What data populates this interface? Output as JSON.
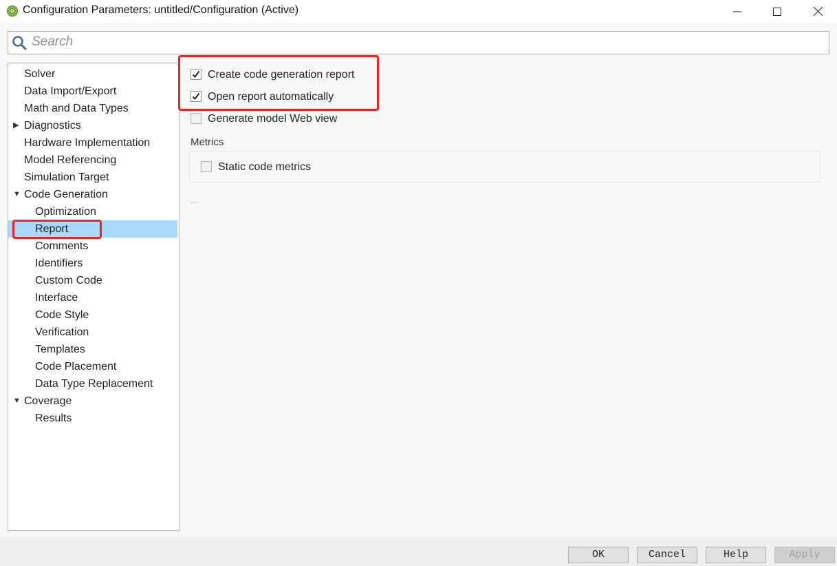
{
  "window": {
    "title": "Configuration Parameters: untitled/Configuration (Active)"
  },
  "search": {
    "placeholder": "Search"
  },
  "tree": {
    "items": [
      {
        "label": "Solver"
      },
      {
        "label": "Data Import/Export"
      },
      {
        "label": "Math and Data Types"
      },
      {
        "label": "Diagnostics",
        "expander": "collapsed"
      },
      {
        "label": "Hardware Implementation"
      },
      {
        "label": "Model Referencing"
      },
      {
        "label": "Simulation Target"
      },
      {
        "label": "Code Generation",
        "expander": "expanded"
      },
      {
        "label": "Optimization"
      },
      {
        "label": "Report",
        "selected": true
      },
      {
        "label": "Comments"
      },
      {
        "label": "Identifiers"
      },
      {
        "label": "Custom Code"
      },
      {
        "label": "Interface"
      },
      {
        "label": "Code Style"
      },
      {
        "label": "Verification"
      },
      {
        "label": "Templates"
      },
      {
        "label": "Code Placement"
      },
      {
        "label": "Data Type Replacement"
      },
      {
        "label": "Coverage",
        "expander": "expanded"
      },
      {
        "label": "Results"
      }
    ]
  },
  "report": {
    "create_report": {
      "label": "Create code generation report",
      "checked": true
    },
    "open_report": {
      "label": "Open report automatically",
      "checked": true
    },
    "web_view": {
      "label": "Generate model Web view",
      "checked": false
    },
    "metrics_label": "Metrics",
    "static_metrics": {
      "label": "Static code metrics",
      "checked": false
    },
    "ellipsis": "..."
  },
  "buttons": {
    "ok": "OK",
    "cancel": "Cancel",
    "help": "Help",
    "apply": "Apply"
  },
  "colors": {
    "selection": "#a9d8f8",
    "annotation_red": "#ee2222"
  }
}
